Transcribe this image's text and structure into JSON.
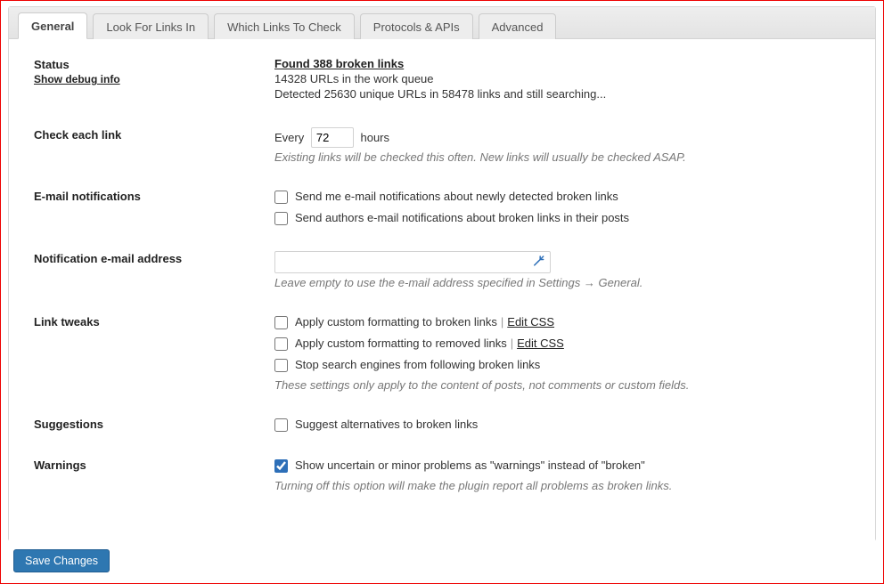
{
  "tabs": [
    {
      "label": "General",
      "active": true
    },
    {
      "label": "Look For Links In",
      "active": false
    },
    {
      "label": "Which Links To Check",
      "active": false
    },
    {
      "label": "Protocols & APIs",
      "active": false
    },
    {
      "label": "Advanced",
      "active": false
    }
  ],
  "status": {
    "label": "Status",
    "debug_link": "Show debug info",
    "found_link": "Found 388 broken links",
    "queue_line": "14328 URLs in the work queue",
    "detected_line": "Detected 25630 unique URLs in 58478 links and still searching..."
  },
  "check_each": {
    "label": "Check each link",
    "prefix": "Every",
    "value": "72",
    "suffix": "hours",
    "hint": "Existing links will be checked this often. New links will usually be checked ASAP."
  },
  "email_notifications": {
    "label": "E-mail notifications",
    "opt_me": "Send me e-mail notifications about newly detected broken links",
    "opt_authors": "Send authors e-mail notifications about broken links in their posts"
  },
  "notification_email": {
    "label": "Notification e-mail address",
    "value": "",
    "hint": "Leave empty to use the e-mail address specified in Settings → General."
  },
  "link_tweaks": {
    "label": "Link tweaks",
    "opt_broken": "Apply custom formatting to broken links",
    "opt_removed": "Apply custom formatting to removed links",
    "opt_noindex": "Stop search engines from following broken links",
    "edit_css": "Edit CSS",
    "hint": "These settings only apply to the content of posts, not comments or custom fields."
  },
  "suggestions": {
    "label": "Suggestions",
    "opt": "Suggest alternatives to broken links"
  },
  "warnings": {
    "label": "Warnings",
    "opt": "Show uncertain or minor problems as \"warnings\" instead of \"broken\"",
    "hint": "Turning off this option will make the plugin report all problems as broken links."
  },
  "save_button": "Save Changes"
}
